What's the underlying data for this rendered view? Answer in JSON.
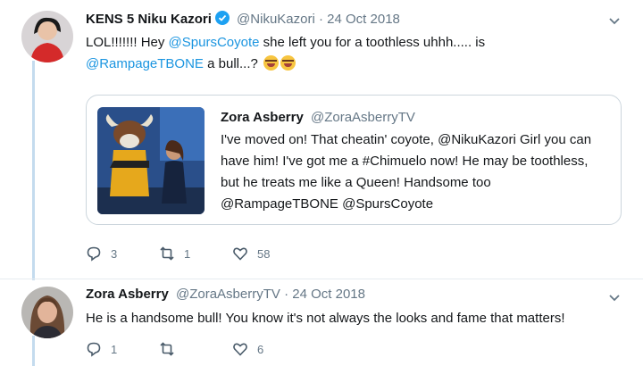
{
  "tweet1": {
    "name": "KENS 5 Niku Kazori",
    "handle": "@NikuKazori",
    "separator": "·",
    "date": "24 Oct 2018",
    "text": {
      "part1": "LOL!!!!!!! Hey ",
      "mention1": "@SpursCoyote",
      "part2": " she left you for a toothless uhhh..... is",
      "mention2": "@RampageTBONE",
      "part3": " a bull...?"
    },
    "quote": {
      "name": "Zora Asberry",
      "handle": "@ZoraAsberryTV",
      "text": "I've moved on! That cheatin' coyote, @NikuKazori Girl you can have him! I've got me a #Chimuelo now! He may be toothless, but he treats me like a Queen! Handsome too @RampageTBONE @SpursCoyote"
    },
    "actions": {
      "replies": "3",
      "retweets": "1",
      "likes": "58"
    }
  },
  "tweet2": {
    "name": "Zora Asberry",
    "handle": "@ZoraAsberryTV",
    "separator": "·",
    "date": "24 Oct 2018",
    "text": "He is a handsome bull! You know it's not always the looks and fame that matters!",
    "actions": {
      "replies": "1",
      "retweets": "",
      "likes": "6"
    }
  },
  "icons": {
    "verified": "verified-badge-icon",
    "chevron": "chevron-down-icon",
    "reply": "reply-icon",
    "retweet": "retweet-icon",
    "like": "heart-icon",
    "emoji": "face-with-tears-of-joy-emoji"
  },
  "colors": {
    "link": "#1b95e0",
    "muted": "#657786",
    "thread": "#c4dbee",
    "verified": "#1da1f2"
  }
}
